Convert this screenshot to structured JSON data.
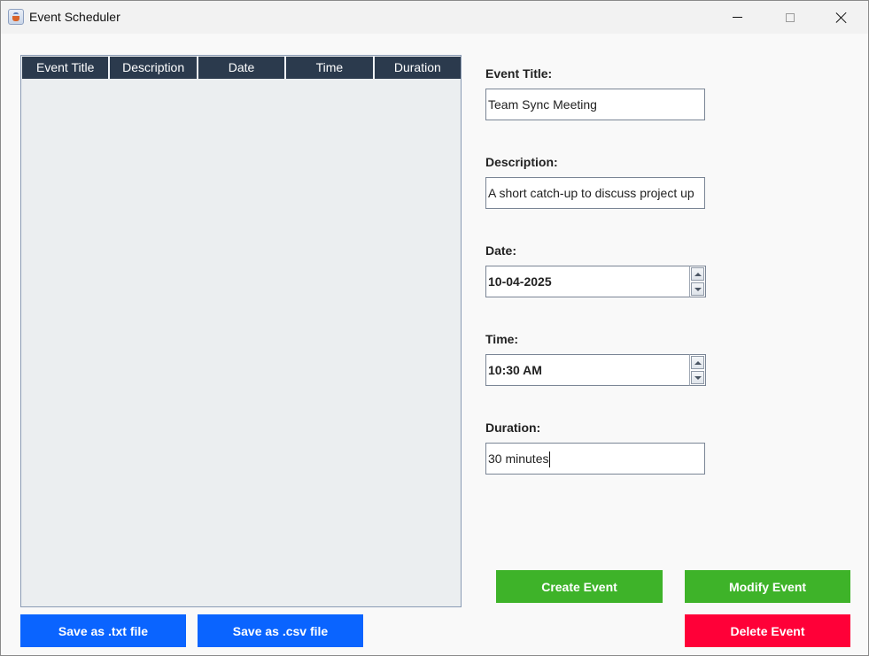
{
  "window": {
    "title": "Event Scheduler",
    "icon": "java-cup-icon"
  },
  "table": {
    "columns": [
      "Event Title",
      "Description",
      "Date",
      "Time",
      "Duration"
    ],
    "rows": []
  },
  "form": {
    "title_label": "Event Title:",
    "title_value": "Team Sync Meeting",
    "description_label": "Description:",
    "description_value": "A short catch-up to discuss project up",
    "date_label": "Date:",
    "date_value": "10-04-2025",
    "time_label": "Time:",
    "time_value": "10:30 AM",
    "duration_label": "Duration:",
    "duration_value": "30 minutes"
  },
  "buttons": {
    "save_txt": "Save as .txt file",
    "save_csv": "Save as .csv file",
    "create": "Create Event",
    "modify": "Modify Event",
    "delete": "Delete Event"
  },
  "colors": {
    "primary": "#0a64ff",
    "success": "#3eb329",
    "danger": "#ff0038",
    "table_header": "#2b3a4d"
  }
}
